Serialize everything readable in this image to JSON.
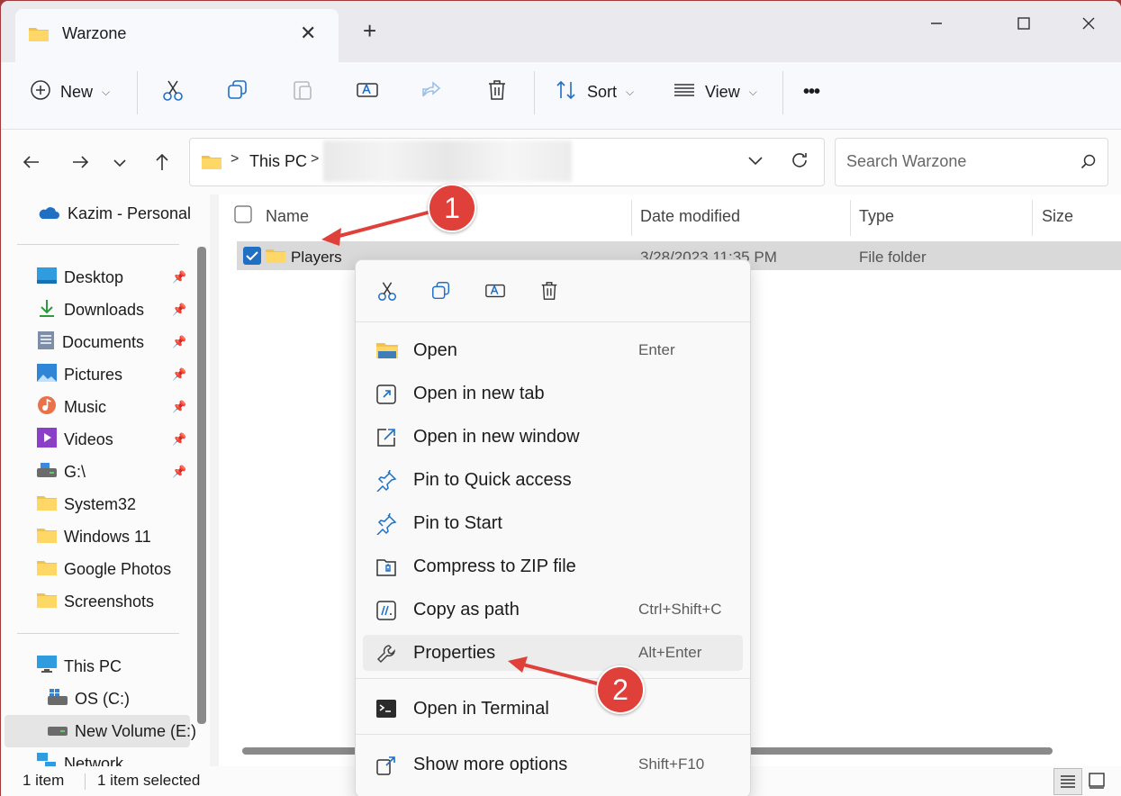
{
  "window": {
    "tab_title": "Warzone",
    "new_tab_symbol": "+"
  },
  "toolbar": {
    "new_label": "New",
    "sort_label": "Sort",
    "view_label": "View",
    "more_label": "•••"
  },
  "address": {
    "this_pc": "This PC",
    "separator": ">"
  },
  "search": {
    "placeholder": "Search Warzone"
  },
  "sidebar": {
    "account": "Kazim - Personal",
    "quick": [
      "Desktop",
      "Downloads",
      "Documents",
      "Pictures",
      "Music",
      "Videos",
      "G:\\"
    ],
    "folders": [
      "System32",
      "Windows 11",
      "Google Photos",
      "Screenshots"
    ],
    "this_pc": "This PC",
    "drives": [
      "OS (C:)",
      "New Volume (E:)"
    ],
    "network": "Network"
  },
  "columns": {
    "name": "Name",
    "date": "Date modified",
    "type": "Type",
    "size": "Size"
  },
  "files": [
    {
      "name": "Players",
      "date": "3/28/2023 11:35 PM",
      "type": "File folder",
      "size": ""
    }
  ],
  "context_menu": {
    "items": [
      {
        "label": "Open",
        "shortcut": "Enter"
      },
      {
        "label": "Open in new tab",
        "shortcut": ""
      },
      {
        "label": "Open in new window",
        "shortcut": ""
      },
      {
        "label": "Pin to Quick access",
        "shortcut": ""
      },
      {
        "label": "Pin to Start",
        "shortcut": ""
      },
      {
        "label": "Compress to ZIP file",
        "shortcut": ""
      },
      {
        "label": "Copy as path",
        "shortcut": "Ctrl+Shift+C"
      },
      {
        "label": "Properties",
        "shortcut": "Alt+Enter"
      },
      {
        "label": "Open in Terminal",
        "shortcut": ""
      },
      {
        "label": "Show more options",
        "shortcut": "Shift+F10"
      }
    ]
  },
  "status": {
    "count": "1 item",
    "selected": "1 item selected"
  },
  "annotations": {
    "step1": "1",
    "step2": "2",
    "color": "#e0403a"
  }
}
